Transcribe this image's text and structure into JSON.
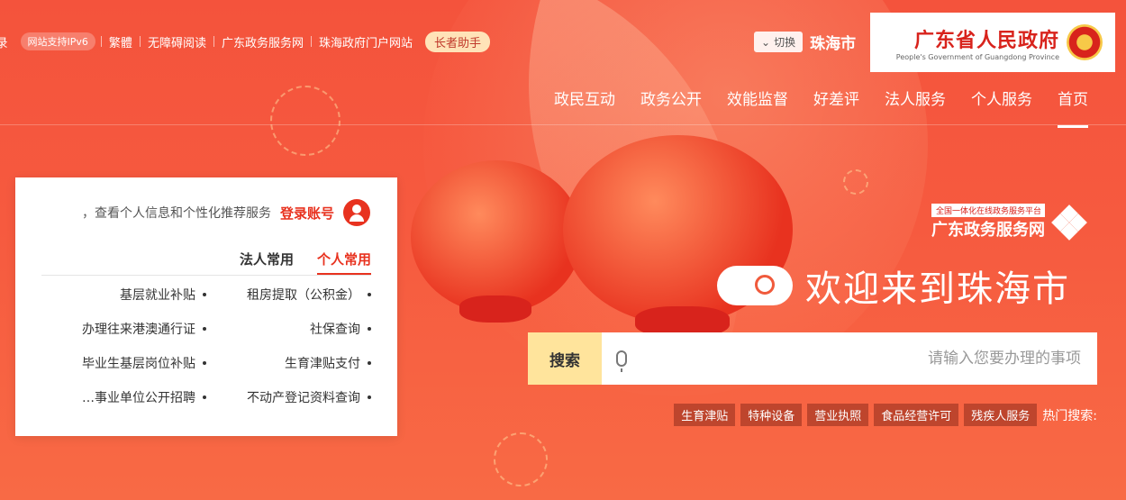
{
  "header": {
    "top_links": [
      "登录",
      "网站支持IPv6",
      "繁體",
      "无障碍阅读",
      "广东政务服务网",
      "珠海政府门户网站",
      "长者助手"
    ],
    "city": {
      "switch_label": "切换",
      "name": "珠海市"
    },
    "brand": {
      "cn": "广东省人民政府",
      "en": "People's Government of Guangdong Province"
    }
  },
  "nav": {
    "items": [
      "首页",
      "个人服务",
      "法人服务",
      "好差评",
      "效能监督",
      "政务公开",
      "政民互动"
    ],
    "active_index": 0
  },
  "portal": {
    "tag": "全国一体化在线政务服务平台",
    "name": "广东政务服务网"
  },
  "welcome": {
    "title": "欢迎来到珠海市"
  },
  "search": {
    "placeholder": "请输入您要办理的事项",
    "value": "",
    "button_label": "搜索"
  },
  "hot_search": {
    "label": "热门搜索:",
    "tags": [
      "残疾人服务",
      "食品经营许可",
      "营业执照",
      "特种设备",
      "生育津贴"
    ]
  },
  "card": {
    "login_link": "登录账号",
    "login_tip": "，查看个人信息和个性化推荐服务",
    "tabs": [
      "个人常用",
      "法人常用"
    ],
    "active_tab": 0,
    "services": [
      "租房提取（公积金）",
      "基层就业补贴",
      "社保查询",
      "办理往来港澳通行证",
      "生育津贴支付",
      "毕业生基层岗位补贴",
      "不动产登记资料查询",
      "事业单位公开招聘…"
    ]
  },
  "colors": {
    "accent": "#e8321f",
    "search_button": "#ffe49c",
    "elder_button": "#ffe3b8"
  },
  "icons": [
    "national-emblem-icon",
    "chevron-down-icon",
    "user-avatar-icon",
    "portal-logo-icon",
    "cloud-icon",
    "microphone-icon"
  ]
}
